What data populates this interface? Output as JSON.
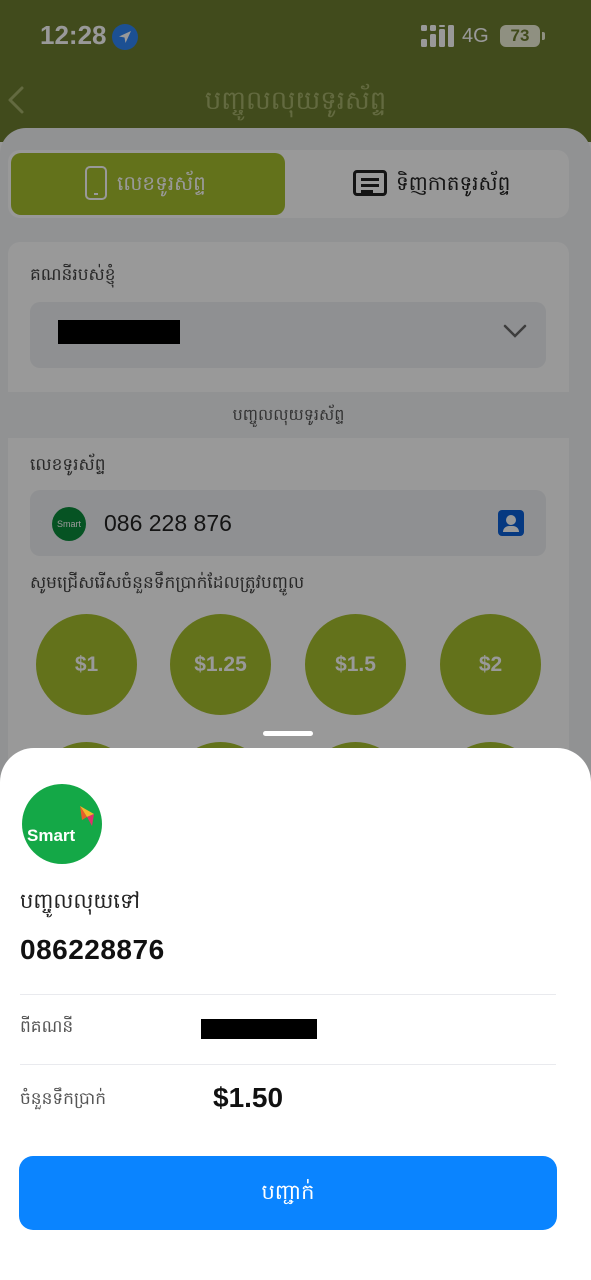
{
  "status_bar": {
    "time": "12:28",
    "network": "4G",
    "battery": "73"
  },
  "header": {
    "title": "បញ្ចូលលុយទូរស័ព្ទ"
  },
  "tabs": [
    {
      "label": "លេខទូរស័ព្ទ",
      "icon": "phone-icon",
      "active": true
    },
    {
      "label": "ទិញកាតទូរស័ព្ទ",
      "icon": "card-icon",
      "active": false
    }
  ],
  "form": {
    "account_label": "គណនីរបស់ខ្ញុំ",
    "section_title": "បញ្ចូលលុយទូរស័ព្ទ",
    "phone_label": "លេខទូរស័ព្ទ",
    "operator_badge": "Smart",
    "phone_value": "086 228 876",
    "choose_label": "សូមជ្រើសរើសចំនួនទឹកប្រាក់ដែលត្រូវបញ្ចូល",
    "amounts": [
      "$1",
      "$1.25",
      "$1.5",
      "$2"
    ]
  },
  "sheet": {
    "operator": "Smart",
    "to_label": "បញ្ចូលលុយទៅ",
    "to_number": "086228876",
    "from_label": "ពីគណនី",
    "amount_label": "ចំនួនទឹកប្រាក់",
    "amount_value": "$1.50",
    "confirm_label": "បញ្ជាក់"
  },
  "colors": {
    "header": "#6d7d2f",
    "accent_green": "#a6be2d",
    "primary_blue": "#0a84ff",
    "smart_green": "#14a847"
  }
}
